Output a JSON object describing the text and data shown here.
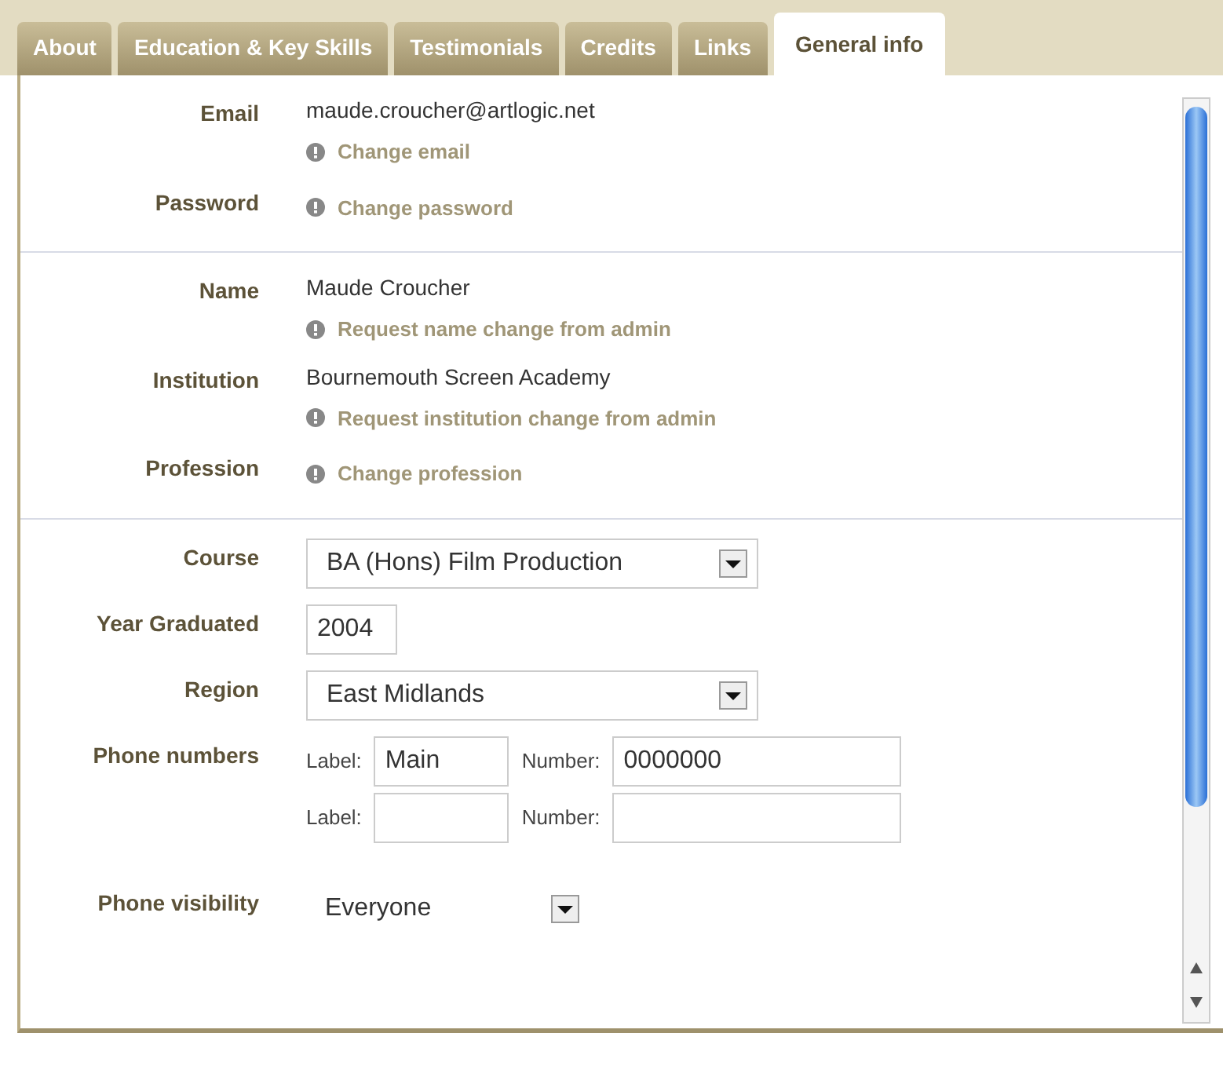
{
  "tabs": [
    {
      "label": "About",
      "selected": false
    },
    {
      "label": "Education & Key Skills",
      "selected": false
    },
    {
      "label": "Testimonials",
      "selected": false
    },
    {
      "label": "Credits",
      "selected": false
    },
    {
      "label": "Links",
      "selected": false
    },
    {
      "label": "General info",
      "selected": true
    }
  ],
  "sections": [
    {
      "fields": [
        {
          "kind": "text",
          "label": "Email",
          "value": "maude.croucher@artlogic.net",
          "action": "Change email"
        },
        {
          "kind": "action",
          "label": "Password",
          "action": "Change password"
        }
      ]
    },
    {
      "fields": [
        {
          "kind": "text",
          "label": "Name",
          "value": "Maude Croucher",
          "action": "Request name change from admin"
        },
        {
          "kind": "text",
          "label": "Institution",
          "value": "Bournemouth Screen Academy",
          "action": "Request institution change from admin"
        },
        {
          "kind": "action",
          "label": "Profession",
          "action": "Change profession"
        }
      ]
    },
    {
      "fields": [
        {
          "kind": "select",
          "label": "Course",
          "value": "BA (Hons) Film Production"
        },
        {
          "kind": "input",
          "label": "Year Graduated",
          "value": "2004"
        },
        {
          "kind": "select",
          "label": "Region",
          "value": "East Midlands"
        },
        {
          "kind": "phones",
          "label": "Phone numbers",
          "rows": [
            {
              "label_caption": "Label:",
              "label_value": "Main",
              "number_caption": "Number:",
              "number_value": "0000000"
            },
            {
              "label_caption": "Label:",
              "number_caption": "Number:"
            }
          ]
        },
        {
          "kind": "plainselect",
          "label": "Phone visibility",
          "value": "Everyone"
        }
      ]
    }
  ]
}
